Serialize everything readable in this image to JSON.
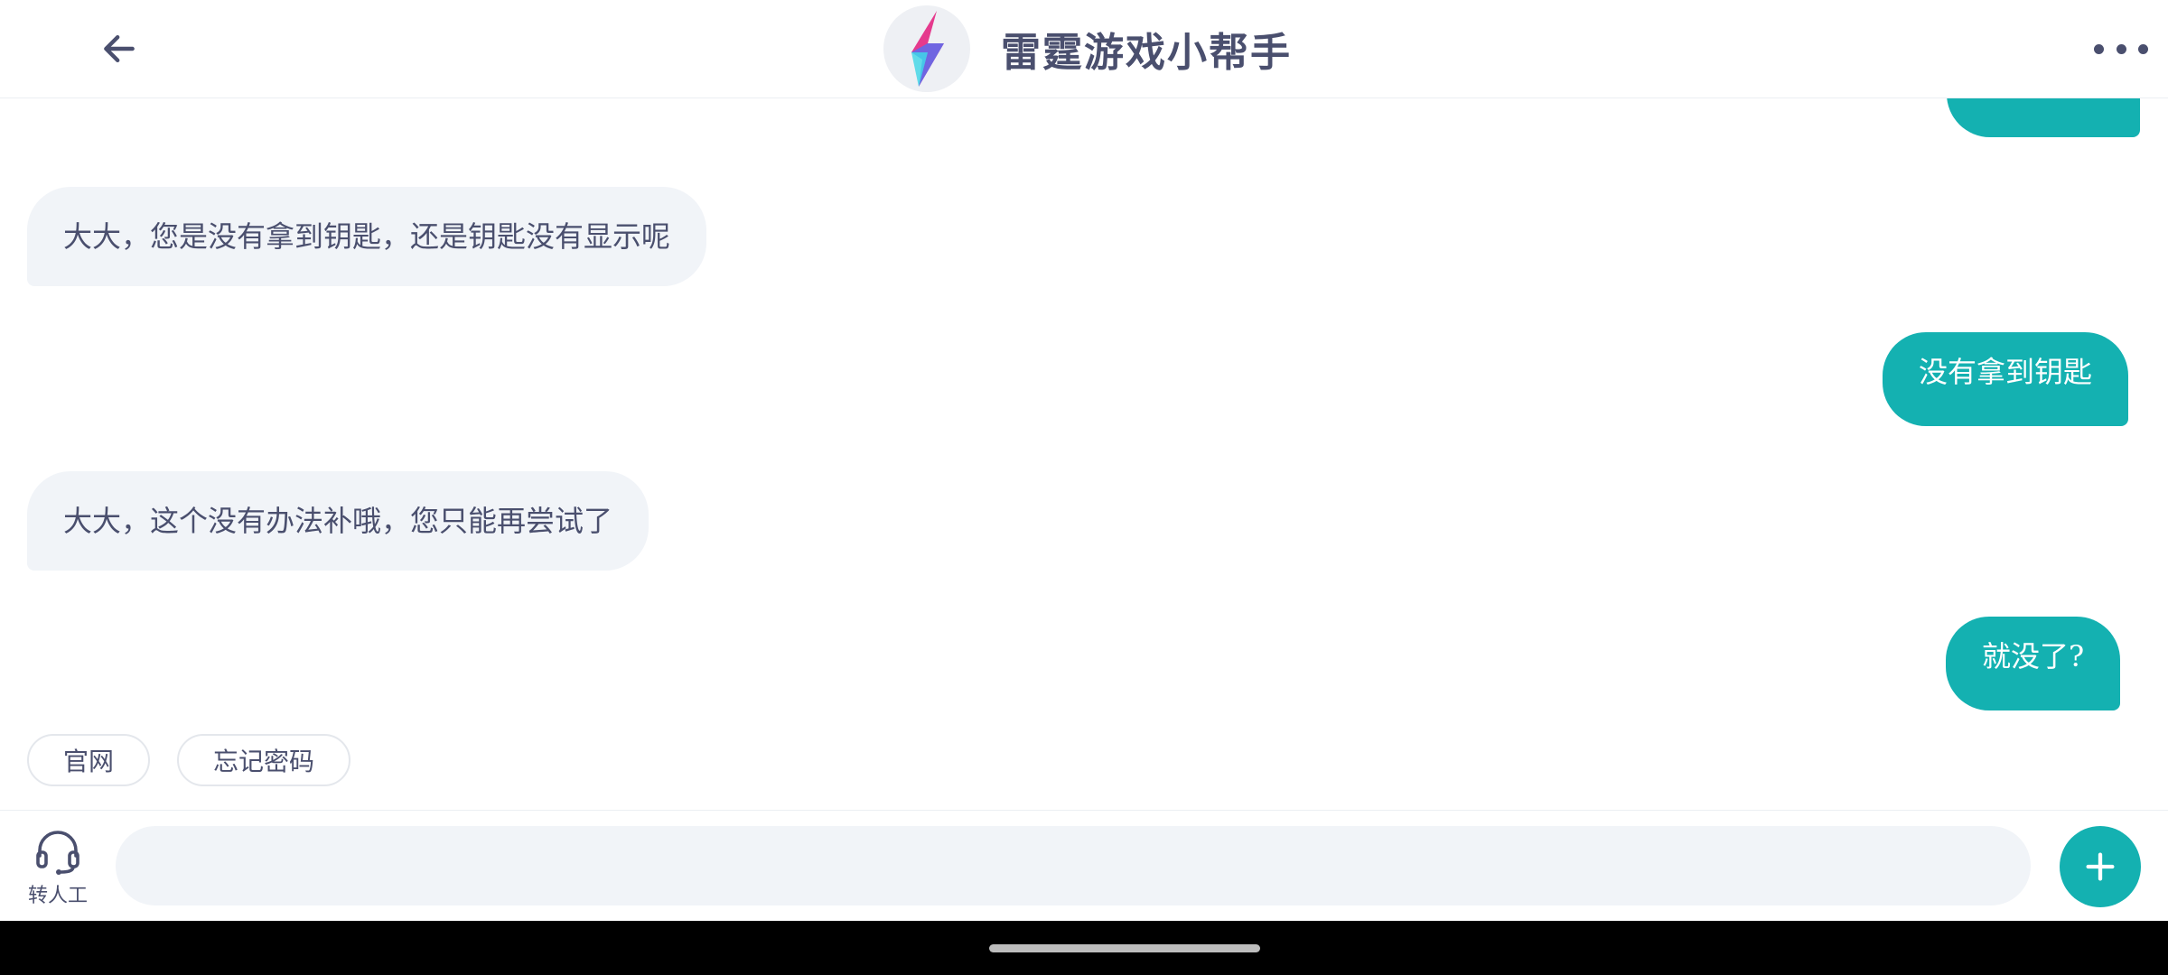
{
  "header": {
    "title": "雷霆游戏小帮手",
    "back_icon": "arrow-left-icon",
    "more_icon": "more-horizontal-icon",
    "logo_icon": "lightning-bolt-logo"
  },
  "messages": [
    {
      "role": "user",
      "text": ""
    },
    {
      "role": "bot",
      "text": "大大，您是没有拿到钥匙，还是钥匙没有显示呢"
    },
    {
      "role": "user",
      "text": "没有拿到钥匙"
    },
    {
      "role": "bot",
      "text": "大大，这个没有办法补哦，您只能再尝试了"
    },
    {
      "role": "user",
      "text": "就没了?"
    }
  ],
  "quick_replies": [
    "官网",
    "忘记密码"
  ],
  "input": {
    "agent_label": "转人工",
    "agent_icon": "headset-icon",
    "placeholder": "",
    "value": "",
    "plus_icon": "plus-icon"
  },
  "colors": {
    "accent": "#14b1b1",
    "bot_bubble": "#f1f4f8",
    "text": "#4a4f6e"
  }
}
